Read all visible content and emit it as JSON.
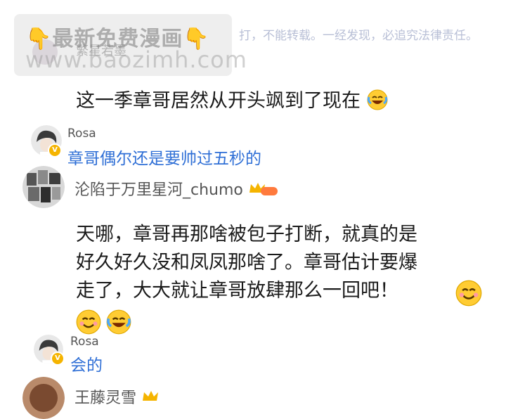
{
  "watermark": {
    "title": "最新免费漫画",
    "site": "www.baozimh.com",
    "blurred_name": "繁星若墨",
    "copyright": "打，不能转载。一经发现，必追究法律责任。"
  },
  "comments": [
    {
      "text": "这一季章哥居然从开头飒到了现在",
      "emoji": "laughing-tears"
    },
    {
      "reply_user": "Rosa",
      "reply_text": "章哥偶尔还是要帅过五秒的"
    },
    {
      "user": "沦陷于万里星河_chumo",
      "badge": "crown-vip",
      "text_lines": [
        "天哪，章哥再那啥被包子打断，就真的是",
        "好久好久没和凤凤那啥了。章哥估计要爆",
        "走了，大大就让章哥放肆那么一回吧！"
      ],
      "emojis": [
        "smiling-face",
        "smiling-face",
        "laughing-tears"
      ]
    },
    {
      "reply_user": "Rosa",
      "reply_text": "会的"
    },
    {
      "user": "王藤灵雪",
      "badge": "crown-vip"
    }
  ],
  "colors": {
    "reply_blue": "#2f6fd6",
    "badge_gold": "#f5b400"
  }
}
